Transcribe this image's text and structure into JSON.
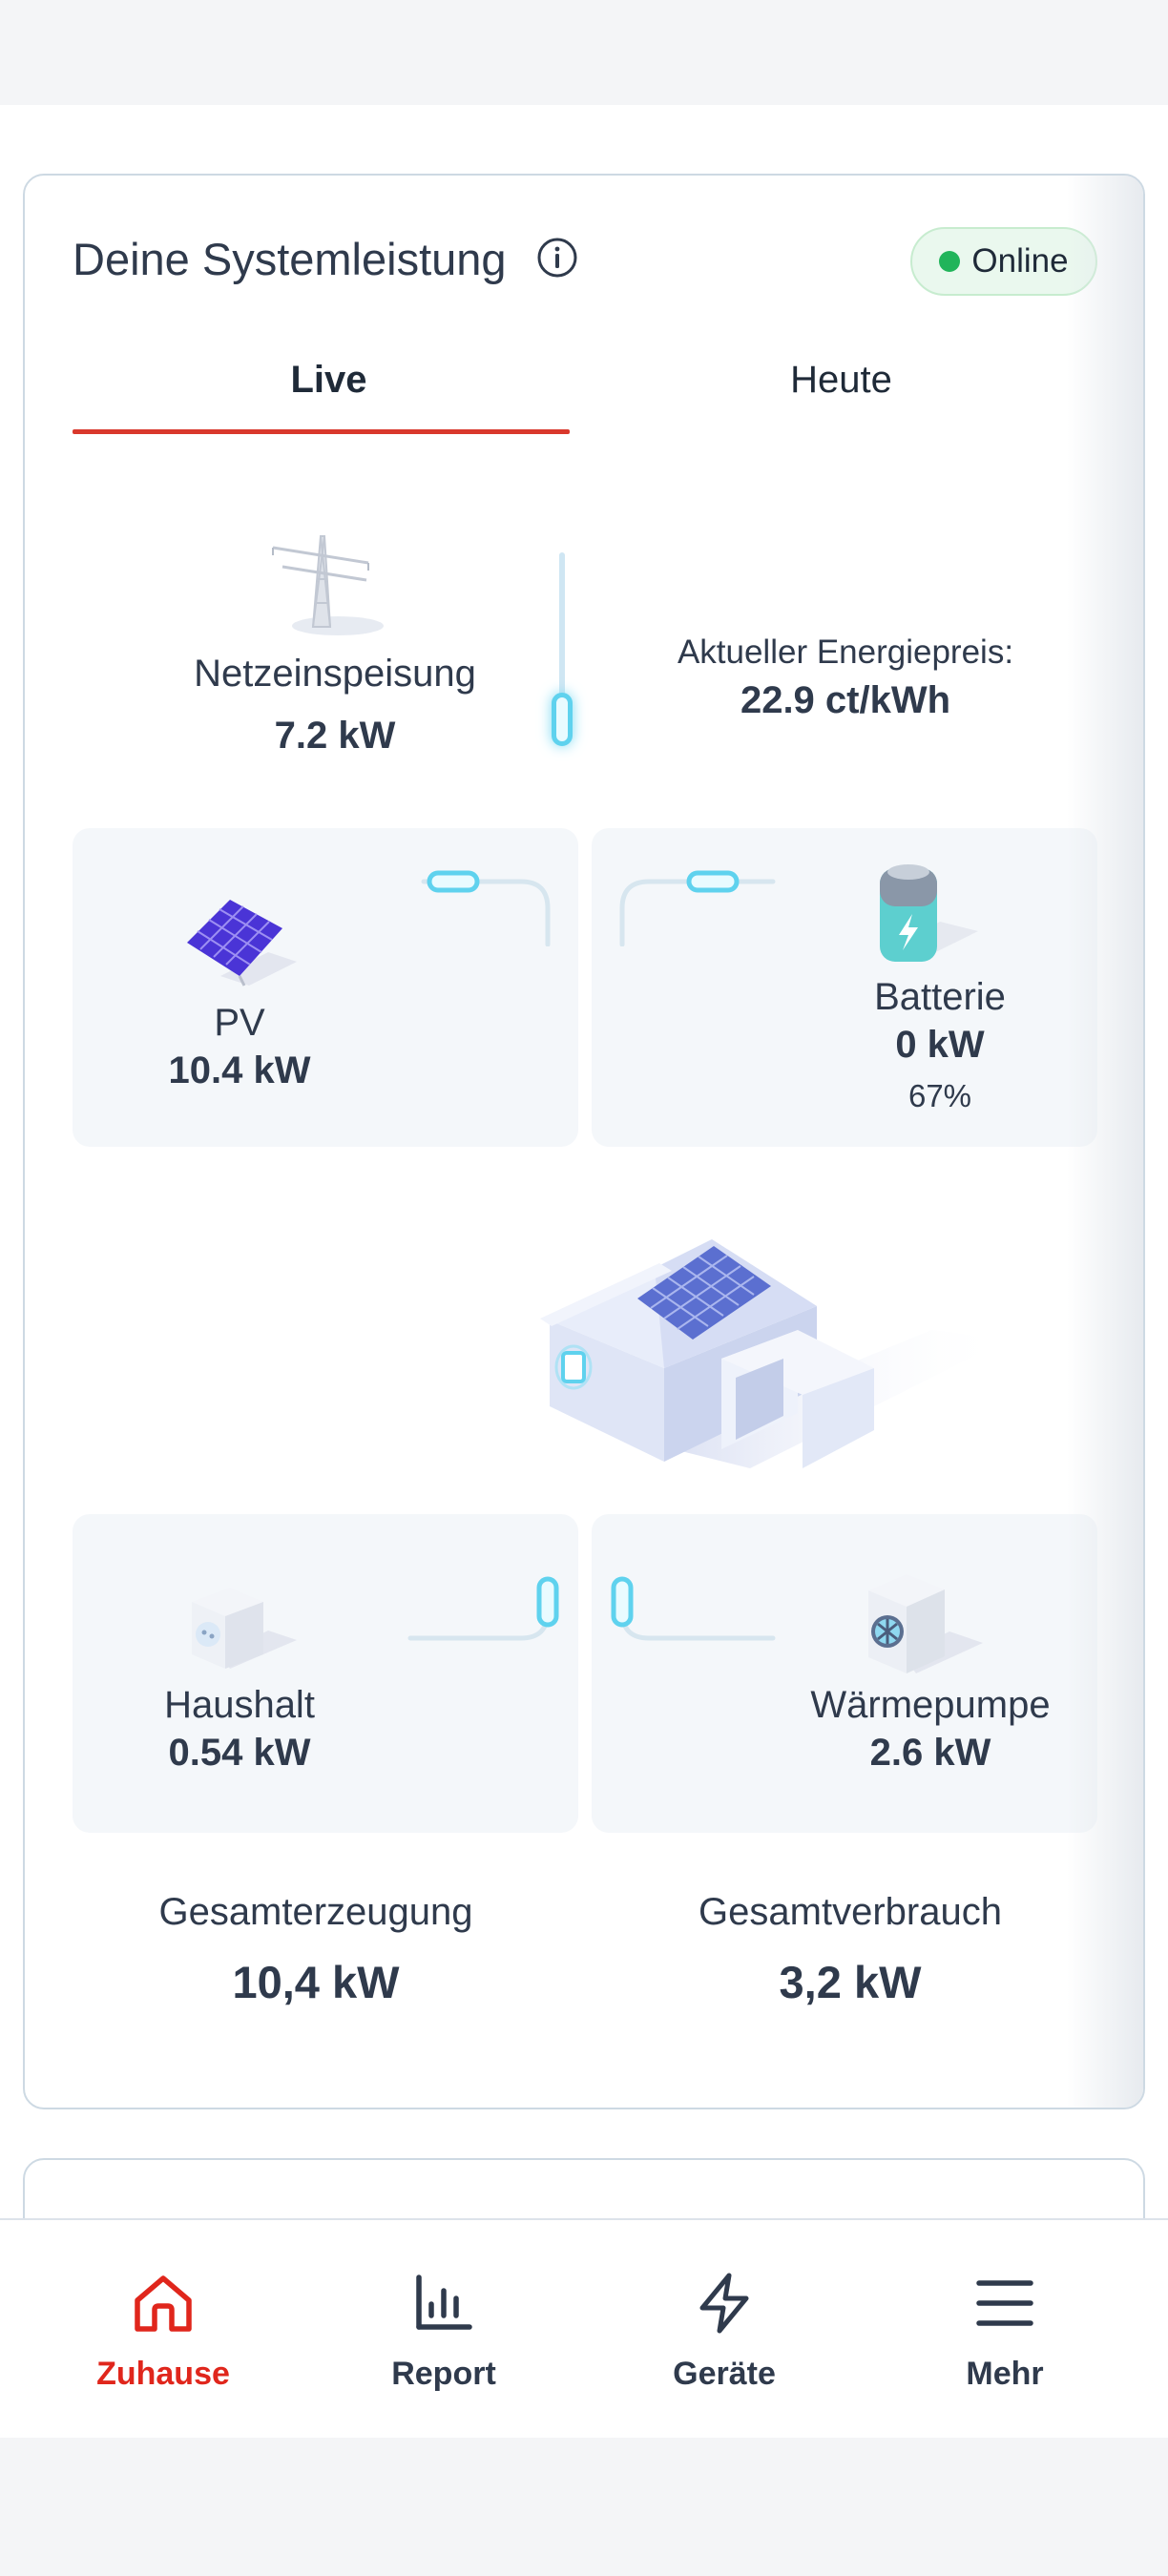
{
  "card": {
    "title": "Deine Systemleistung",
    "status": "Online"
  },
  "tabs": [
    {
      "label": "Live",
      "active": true
    },
    {
      "label": "Heute",
      "active": false
    }
  ],
  "grid": {
    "label": "Netzeinspeisung",
    "value": "7.2 kW"
  },
  "price": {
    "label": "Aktueller Energiepreis:",
    "value": "22.9 ct/kWh"
  },
  "pv": {
    "label": "PV",
    "value": "10.4 kW"
  },
  "battery": {
    "label": "Batterie",
    "value": "0 kW",
    "charge": "67%"
  },
  "household": {
    "label": "Haushalt",
    "value": "0.54 kW"
  },
  "heatpump": {
    "label": "Wärmepumpe",
    "value": "2.6 kW"
  },
  "totals": {
    "generation_label": "Gesamterzeugung",
    "generation_value": "10,4 kW",
    "consumption_label": "Gesamtverbrauch",
    "consumption_value": "3,2 kW"
  },
  "nav": [
    {
      "label": "Zuhause",
      "icon": "home-icon",
      "active": true
    },
    {
      "label": "Report",
      "icon": "bar-chart-icon",
      "active": false
    },
    {
      "label": "Geräte",
      "icon": "lightning-icon",
      "active": false
    },
    {
      "label": "Mehr",
      "icon": "menu-icon",
      "active": false
    }
  ],
  "colors": {
    "accent": "#e0261c",
    "tab_underline": "#d9382c",
    "online": "#21b45a",
    "flow": "#5fd2ee",
    "text": "#2f3a4c"
  }
}
